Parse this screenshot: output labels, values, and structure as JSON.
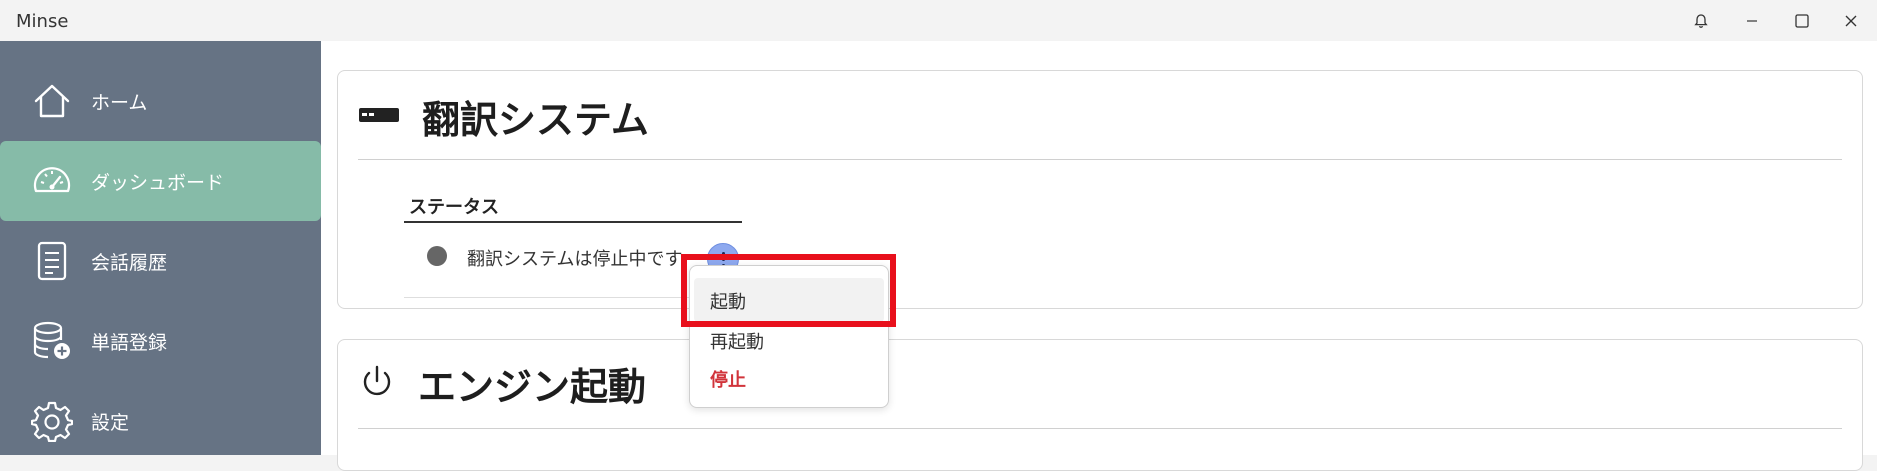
{
  "window": {
    "title": "Minse",
    "controls": [
      "bell-icon",
      "minimize-icon",
      "maximize-icon",
      "close-icon"
    ]
  },
  "sidebar": {
    "items": [
      {
        "label": "ホーム",
        "icon": "home-icon",
        "active": false
      },
      {
        "label": "ダッシュボード",
        "icon": "dashboard-gauge-icon",
        "active": true
      },
      {
        "label": "会話履歴",
        "icon": "document-icon",
        "active": false
      },
      {
        "label": "単語登録",
        "icon": "database-add-icon",
        "active": false
      },
      {
        "label": "設定",
        "icon": "gear-icon",
        "active": false
      }
    ],
    "colors": {
      "background": "#667384",
      "active": "#86bba8"
    }
  },
  "translation_card": {
    "title": "翻訳システム",
    "icon": "server-icon",
    "status_header": "ステータス",
    "status_text": "翻訳システムは停止中です",
    "status_color": "#666666",
    "menu_icon": "kebab-menu-icon"
  },
  "context_menu": {
    "items": [
      {
        "label": "起動",
        "hovered": true
      },
      {
        "label": "再起動"
      },
      {
        "label": "停止",
        "danger": true
      }
    ],
    "highlight_color": "#e8101c",
    "danger_color": "#d1343b"
  },
  "engine_card": {
    "title": "エンジン起動",
    "icon": "power-icon"
  }
}
